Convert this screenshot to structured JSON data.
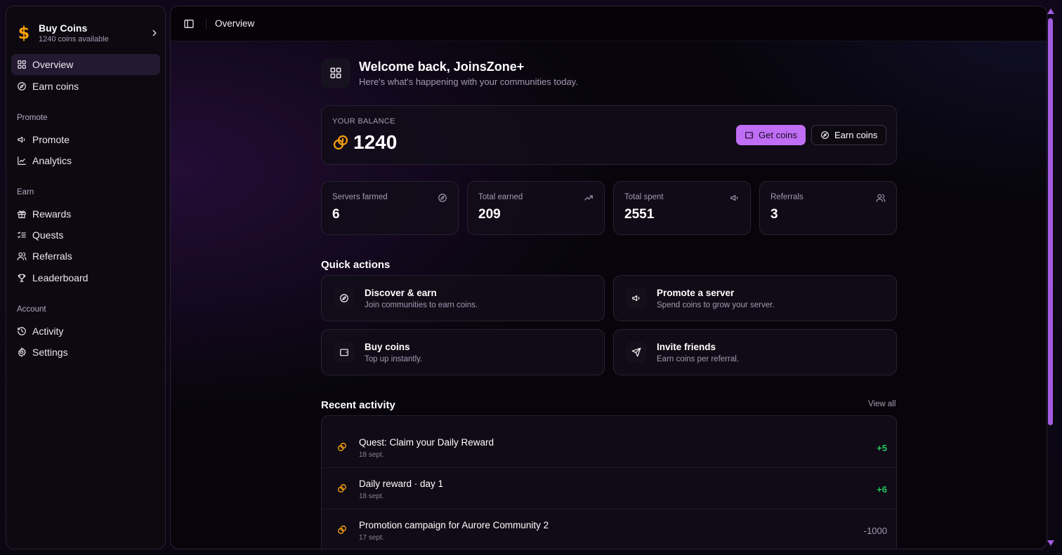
{
  "sidebar": {
    "buy_card": {
      "title": "Buy Coins",
      "subtitle": "1240 coins available",
      "icon": "dollar-icon"
    },
    "nav_top": [
      {
        "label": "Overview",
        "icon": "grid-icon",
        "active": true
      },
      {
        "label": "Earn coins",
        "icon": "compass-icon"
      }
    ],
    "sections": [
      {
        "label": "Promote",
        "items": [
          {
            "label": "Promote",
            "icon": "megaphone-icon"
          },
          {
            "label": "Analytics",
            "icon": "chart-line-icon"
          }
        ]
      },
      {
        "label": "Earn",
        "items": [
          {
            "label": "Rewards",
            "icon": "gift-icon"
          },
          {
            "label": "Quests",
            "icon": "list-checks-icon"
          },
          {
            "label": "Referrals",
            "icon": "users-icon"
          },
          {
            "label": "Leaderboard",
            "icon": "trophy-icon"
          }
        ]
      },
      {
        "label": "Account",
        "items": [
          {
            "label": "Activity",
            "icon": "history-icon"
          },
          {
            "label": "Settings",
            "icon": "gear-icon"
          }
        ]
      }
    ]
  },
  "topbar": {
    "breadcrumb": "Overview",
    "toggle_icon": "sidebar-toggle-icon"
  },
  "welcome": {
    "title": "Welcome back, JoinsZone+",
    "subtitle": "Here's what's happening with your communities today."
  },
  "balance": {
    "label": "YOUR BALANCE",
    "amount": "1240",
    "get_coins": "Get coins",
    "earn_coins": "Earn coins"
  },
  "stats": [
    {
      "label": "Servers farmed",
      "value": "6",
      "icon": "compass-icon"
    },
    {
      "label": "Total earned",
      "value": "209",
      "icon": "trending-up-icon"
    },
    {
      "label": "Total spent",
      "value": "2551",
      "icon": "megaphone-icon"
    },
    {
      "label": "Referrals",
      "value": "3",
      "icon": "users-icon"
    }
  ],
  "quick_actions": {
    "heading": "Quick actions",
    "items": [
      {
        "title": "Discover & earn",
        "desc": "Join communities to earn coins.",
        "icon": "compass-icon"
      },
      {
        "title": "Promote a server",
        "desc": "Spend coins to grow your server.",
        "icon": "megaphone-icon"
      },
      {
        "title": "Buy coins",
        "desc": "Top up instantly.",
        "icon": "wallet-icon"
      },
      {
        "title": "Invite friends",
        "desc": "Earn coins per referral.",
        "icon": "send-icon"
      }
    ]
  },
  "recent_activity": {
    "heading": "Recent activity",
    "view_all": "View all",
    "rows": [
      {
        "title": "Quest: Claim your Daily Reward",
        "date": "18 sept.",
        "amount": "+5",
        "kind": "positive"
      },
      {
        "title": "Daily reward · day 1",
        "date": "18 sept.",
        "amount": "+6",
        "kind": "positive"
      },
      {
        "title": "Promotion campaign for Aurore Community 2",
        "date": "17 sept.",
        "amount": "-1000",
        "kind": "negative"
      }
    ]
  },
  "colors": {
    "accent": "#c06ef5",
    "coin": "#f59e0b",
    "positive": "#22c55e"
  }
}
